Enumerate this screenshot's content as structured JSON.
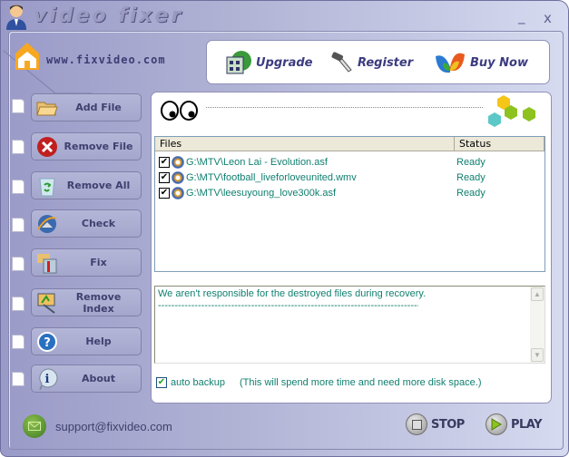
{
  "window": {
    "title": "video fixer",
    "minimize": "_",
    "close": "x"
  },
  "header": {
    "url": "www.fixvideo.com"
  },
  "toolbar": {
    "upgrade": "Upgrade",
    "register": "Register",
    "buy_now": "Buy Now"
  },
  "sidebar": {
    "items": [
      {
        "label": "Add File",
        "icon": "folder-icon"
      },
      {
        "label": "Remove File",
        "icon": "remove-icon"
      },
      {
        "label": "Remove All",
        "icon": "recycle-bin-icon"
      },
      {
        "label": "Check",
        "icon": "check-icon"
      },
      {
        "label": "Fix",
        "icon": "fix-icon"
      },
      {
        "label": "Remove Index",
        "icon": "remove-index-icon"
      },
      {
        "label": "Help",
        "icon": "help-icon"
      },
      {
        "label": "About",
        "icon": "info-icon"
      }
    ]
  },
  "files": {
    "columns": [
      "Files",
      "Status"
    ],
    "rows": [
      {
        "checked": true,
        "path": "G:\\MTV\\Leon Lai - Evolution.asf",
        "status": "Ready"
      },
      {
        "checked": true,
        "path": "G:\\MTV\\football_liveforloveunited.wmv",
        "status": "Ready"
      },
      {
        "checked": true,
        "path": "G:\\MTV\\leesuyoung_love300k.asf",
        "status": "Ready"
      }
    ]
  },
  "log": {
    "line1": "We aren't responsible for the destroyed files during recovery.",
    "line2": "--------------------------------------------------------------------------------------------"
  },
  "options": {
    "auto_backup_label": "auto backup",
    "auto_backup_checked": true,
    "auto_backup_note": "(This will spend more time and need more disk space.)"
  },
  "footer": {
    "support_email": "support@fixvideo.com",
    "stop": "STOP",
    "play": "PLAY"
  }
}
